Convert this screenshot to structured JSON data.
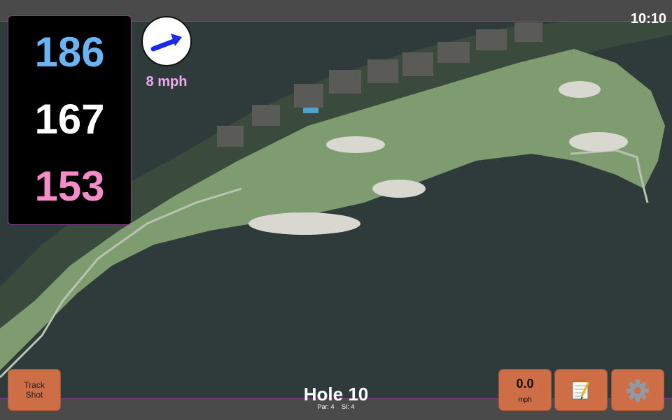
{
  "header": {
    "clock": "10:10"
  },
  "yardages": {
    "back": "186",
    "middle": "167",
    "front": "153"
  },
  "wind": {
    "speed": "8 mph",
    "icon": "wind-arrow-icon"
  },
  "hole": {
    "title": "Hole 10",
    "par": "Par: 4",
    "stroke_index": "SI: 4"
  },
  "toolbar": {
    "track_shot_label_line1": "Track",
    "track_shot_label_line2": "Shot",
    "speed_value": "0.0",
    "speed_unit": "mph",
    "notes_icon": "notepad-icon",
    "settings_icon": "gear-icon"
  },
  "colors": {
    "back": "#6ab4f4",
    "middle": "#ffffff",
    "front": "#f48cc8",
    "wind_text": "#f0a8f0",
    "button": "#cd6e47",
    "accent_border": "#8a3d8a",
    "water": "#2e3b3a",
    "fairway": "#7f9c70"
  }
}
